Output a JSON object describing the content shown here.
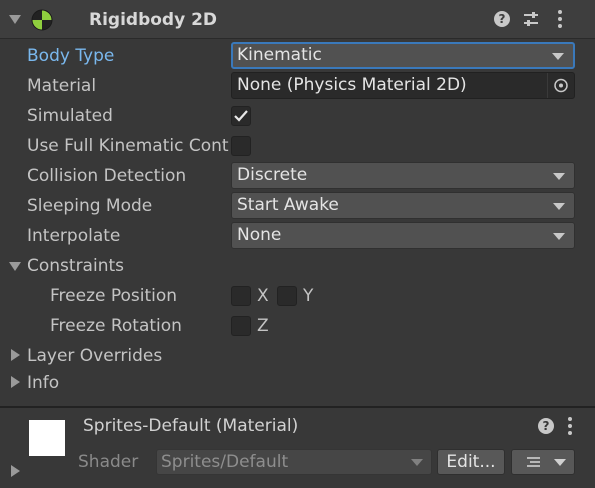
{
  "component": {
    "title": "Rigidbody 2D",
    "help_icon": "help-icon",
    "presets_icon": "presets-icon",
    "more_icon": "more-vertical-icon"
  },
  "properties": {
    "body_type": {
      "label": "Body Type",
      "value": "Kinematic"
    },
    "material": {
      "label": "Material",
      "value": "None (Physics Material 2D)"
    },
    "simulated": {
      "label": "Simulated",
      "checked": true
    },
    "use_full_kinematic": {
      "label": "Use Full Kinematic Contacts",
      "checked": false
    },
    "collision_detection": {
      "label": "Collision Detection",
      "value": "Discrete"
    },
    "sleeping_mode": {
      "label": "Sleeping Mode",
      "value": "Start Awake"
    },
    "interpolate": {
      "label": "Interpolate",
      "value": "None"
    }
  },
  "constraints": {
    "label": "Constraints",
    "freeze_position": {
      "label": "Freeze Position",
      "x": "X",
      "y": "Y"
    },
    "freeze_rotation": {
      "label": "Freeze Rotation",
      "z": "Z"
    }
  },
  "sections": {
    "layer_overrides": "Layer Overrides",
    "info": "Info"
  },
  "material_component": {
    "title": "Sprites-Default (Material)",
    "shader_label": "Shader",
    "shader_value": "Sprites/Default",
    "edit_button": "Edit..."
  },
  "colors": {
    "background": "#383838",
    "accent": "#3a79bb",
    "label_highlight": "#7ab8ee"
  }
}
